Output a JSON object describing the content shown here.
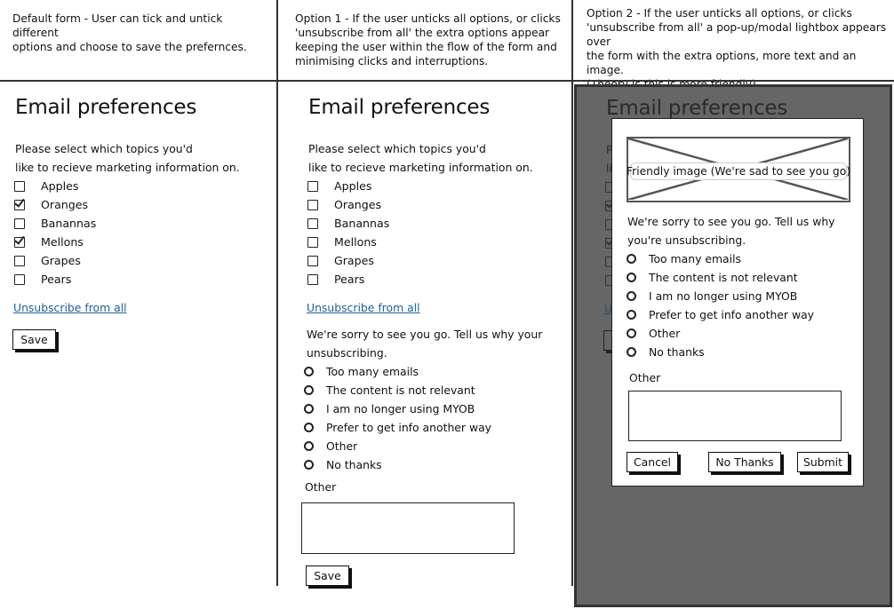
{
  "columns": [
    {
      "description": [
        "Default form - User can tick and untick different",
        "options and choose to save the prefernces."
      ]
    },
    {
      "description": [
        "Option 1 - If the user unticks all options, or clicks",
        "'unsubscribe from all' the extra options appear",
        "keeping the user within the flow of the form and",
        "minimising clicks and interruptions."
      ]
    },
    {
      "description": [
        "Option 2 - If the user unticks all options, or clicks",
        "'unsubscribe from all' a pop-up/modal lightbox appears over",
        "the form with the extra options, more text and an image.",
        "(Theory is this is more friendly)"
      ]
    }
  ],
  "form": {
    "title": "Email preferences",
    "intro_line1": "Please select which topics you'd",
    "intro_line2": "like to recieve marketing information on.",
    "unsubscribe_link": "Unsubscribe from all",
    "save_label": "Save"
  },
  "default_topics": [
    {
      "label": "Apples",
      "checked": false
    },
    {
      "label": "Oranges",
      "checked": true
    },
    {
      "label": "Banannas",
      "checked": false
    },
    {
      "label": "Mellons",
      "checked": true
    },
    {
      "label": "Grapes",
      "checked": false
    },
    {
      "label": "Pears",
      "checked": false
    }
  ],
  "option1_topics": [
    {
      "label": "Apples",
      "checked": false
    },
    {
      "label": "Oranges",
      "checked": false
    },
    {
      "label": "Banannas",
      "checked": false
    },
    {
      "label": "Mellons",
      "checked": false
    },
    {
      "label": "Grapes",
      "checked": false
    },
    {
      "label": "Pears",
      "checked": false
    }
  ],
  "option1": {
    "sorry_line1": "We're sorry to see you go. Tell us why your",
    "sorry_line2": "unsubscribing.",
    "other_label": "Other",
    "other_value": "",
    "save_label": "Save"
  },
  "reasons": [
    "Too many emails",
    "The content is not relevant",
    "I am no longer using MYOB",
    "Prefer to get info another way",
    "Other",
    "No thanks"
  ],
  "modal": {
    "image_caption": "Friendly image (We're sad to see you go)",
    "sorry_line1": "We're sorry to see you go. Tell us why",
    "sorry_line2": "you're unsubscribing.",
    "other_label": "Other",
    "other_value": "",
    "cancel_label": "Cancel",
    "no_thanks_label": "No Thanks",
    "submit_label": "Submit"
  },
  "colors": {
    "link": "#1f5f99",
    "overlay": "#666666",
    "ink": "#111111"
  }
}
